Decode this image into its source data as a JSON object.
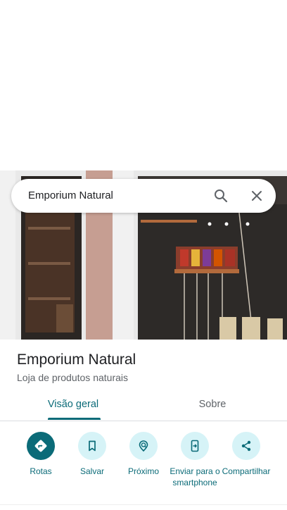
{
  "search": {
    "query": "Emporium Natural"
  },
  "place": {
    "name": "Emporium Natural",
    "category": "Loja de produtos naturais"
  },
  "tabs": [
    {
      "label": "Visão geral"
    },
    {
      "label": "Sobre"
    }
  ],
  "actions": [
    {
      "label": "Rotas",
      "icon": "directions-icon"
    },
    {
      "label": "Salvar",
      "icon": "bookmark-icon"
    },
    {
      "label": "Próximo",
      "icon": "nearby-icon"
    },
    {
      "label": "Enviar para o smartphone",
      "icon": "send-to-phone-icon"
    },
    {
      "label": "Compartilhar",
      "icon": "share-icon"
    }
  ],
  "colors": {
    "accent": "#0b6b78",
    "action_bg": "#d6f3f7",
    "text_primary": "#202124",
    "text_secondary": "#5f6368"
  }
}
